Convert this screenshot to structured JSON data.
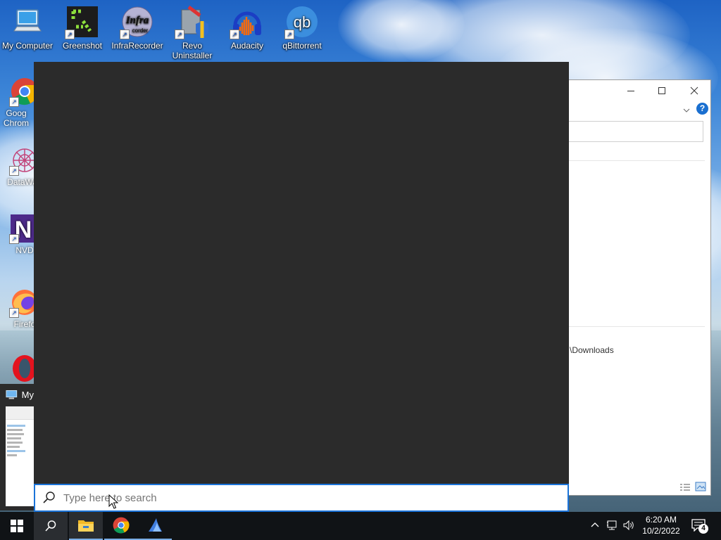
{
  "desktop": {
    "top_icons": [
      {
        "label": "My Computer",
        "icon": "computer-icon"
      },
      {
        "label": "Greenshot",
        "icon": "greenshot-icon"
      },
      {
        "label": "InfraRecorder",
        "icon": "infrarecorder-icon"
      },
      {
        "label": "Revo Uninstaller",
        "icon": "revo-uninstaller-icon"
      },
      {
        "label": "Audacity",
        "icon": "audacity-icon"
      },
      {
        "label": "qBittorrent",
        "icon": "qbittorrent-icon"
      }
    ],
    "left_icons": [
      {
        "label": "Goog Chrom",
        "icon": "chrome-icon"
      },
      {
        "label": "DataWag",
        "icon": "datawag-icon"
      },
      {
        "label": "NVD",
        "icon": "nvda-icon"
      },
      {
        "label": "Firefo",
        "icon": "firefox-icon"
      },
      {
        "label": "",
        "icon": "opera-icon"
      }
    ]
  },
  "taskbar_preview": {
    "title": "My"
  },
  "explorer": {
    "path_fragment": "\\Downloads"
  },
  "search": {
    "placeholder": "Type here to search"
  },
  "taskbar": {
    "time": "6:20 AM",
    "date": "10/2/2022",
    "notification_count": "4"
  },
  "colors": {
    "taskbar": "#101316",
    "start_panel": "#2b2b2b",
    "accent": "#1a73d9"
  }
}
